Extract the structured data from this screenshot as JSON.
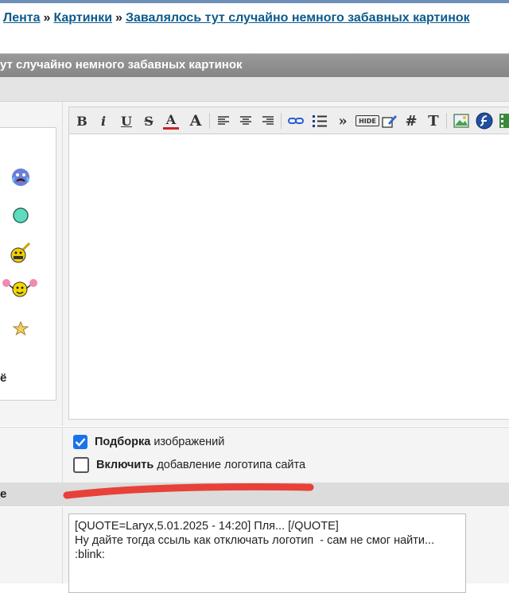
{
  "breadcrumb": {
    "items": [
      "Лента",
      "Картинки",
      "Завалялось тут случайно немного забавных картинок"
    ],
    "separator": "»"
  },
  "title_bar": {
    "text": "ут случайно немного забавных картинок"
  },
  "toolbar": {
    "buttons": [
      "B",
      "i",
      "U",
      "S",
      "A",
      "A",
      "align-left",
      "align-center",
      "align-right",
      "link",
      "list",
      "»",
      "HIDE",
      "edit",
      "#",
      "T",
      "image",
      "flash",
      "media"
    ]
  },
  "smilies": [
    "crying-smiley-icon",
    "green-circle-smiley-icon",
    "guitar-smiley-icon",
    "cheerleader-smiley-icon",
    "star-smiley-icon"
  ],
  "left_label_fragment": "ё",
  "options": {
    "picker_bold": "Подборка",
    "picker_rest": " изображений",
    "logo_bold": "Включить",
    "logo_rest": " добавление логотипа сайта",
    "picker_checked": true,
    "logo_checked": false
  },
  "graybar_label": "е",
  "quote": {
    "text": "[QUOTE=Laryx,5.01.2025 - 14:20] Пля... [/QUOTE]\nНу дайте тогда ссыль как отключать логотип  - сам не смог найти...\n:blink:"
  },
  "colors": {
    "link": "#0b5a8c",
    "title_bar": "#8c8c8c",
    "checkbox": "#1a73e8",
    "annotation": "#e8413a"
  }
}
